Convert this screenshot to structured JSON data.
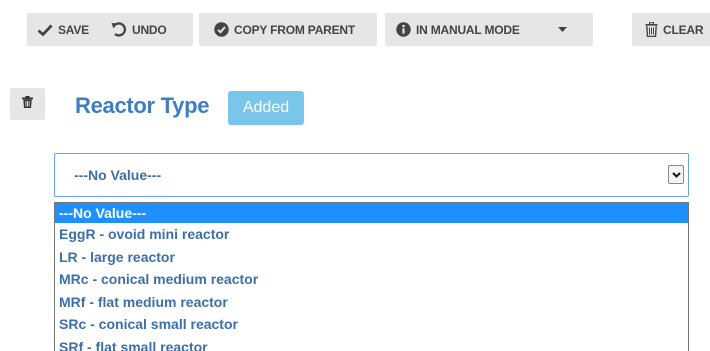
{
  "toolbar": {
    "save_label": "SAVE",
    "undo_label": "UNDO",
    "copy_label": "COPY FROM PARENT",
    "manual_label": "IN MANUAL MODE",
    "clear_label": "CLEAR"
  },
  "field": {
    "title": "Reactor Type",
    "badge": "Added"
  },
  "select": {
    "value": "---No Value---",
    "options": [
      "---No Value---",
      "EggR - ovoid mini reactor",
      "LR - large reactor",
      "MRc - conical medium reactor",
      "MRf - flat medium reactor",
      "SRc - conical small reactor",
      "SRf - flat small reactor"
    ],
    "selected_index": 0
  },
  "colors": {
    "accent_blue": "#3d7ec2",
    "badge_bg": "#7ac5ea",
    "selected_bg": "#1e90ff",
    "button_bg": "#e6e6e6"
  },
  "icons": [
    "check-icon",
    "undo-icon",
    "check-circle-icon",
    "info-circle-icon",
    "caret-down-icon",
    "trash-icon"
  ]
}
